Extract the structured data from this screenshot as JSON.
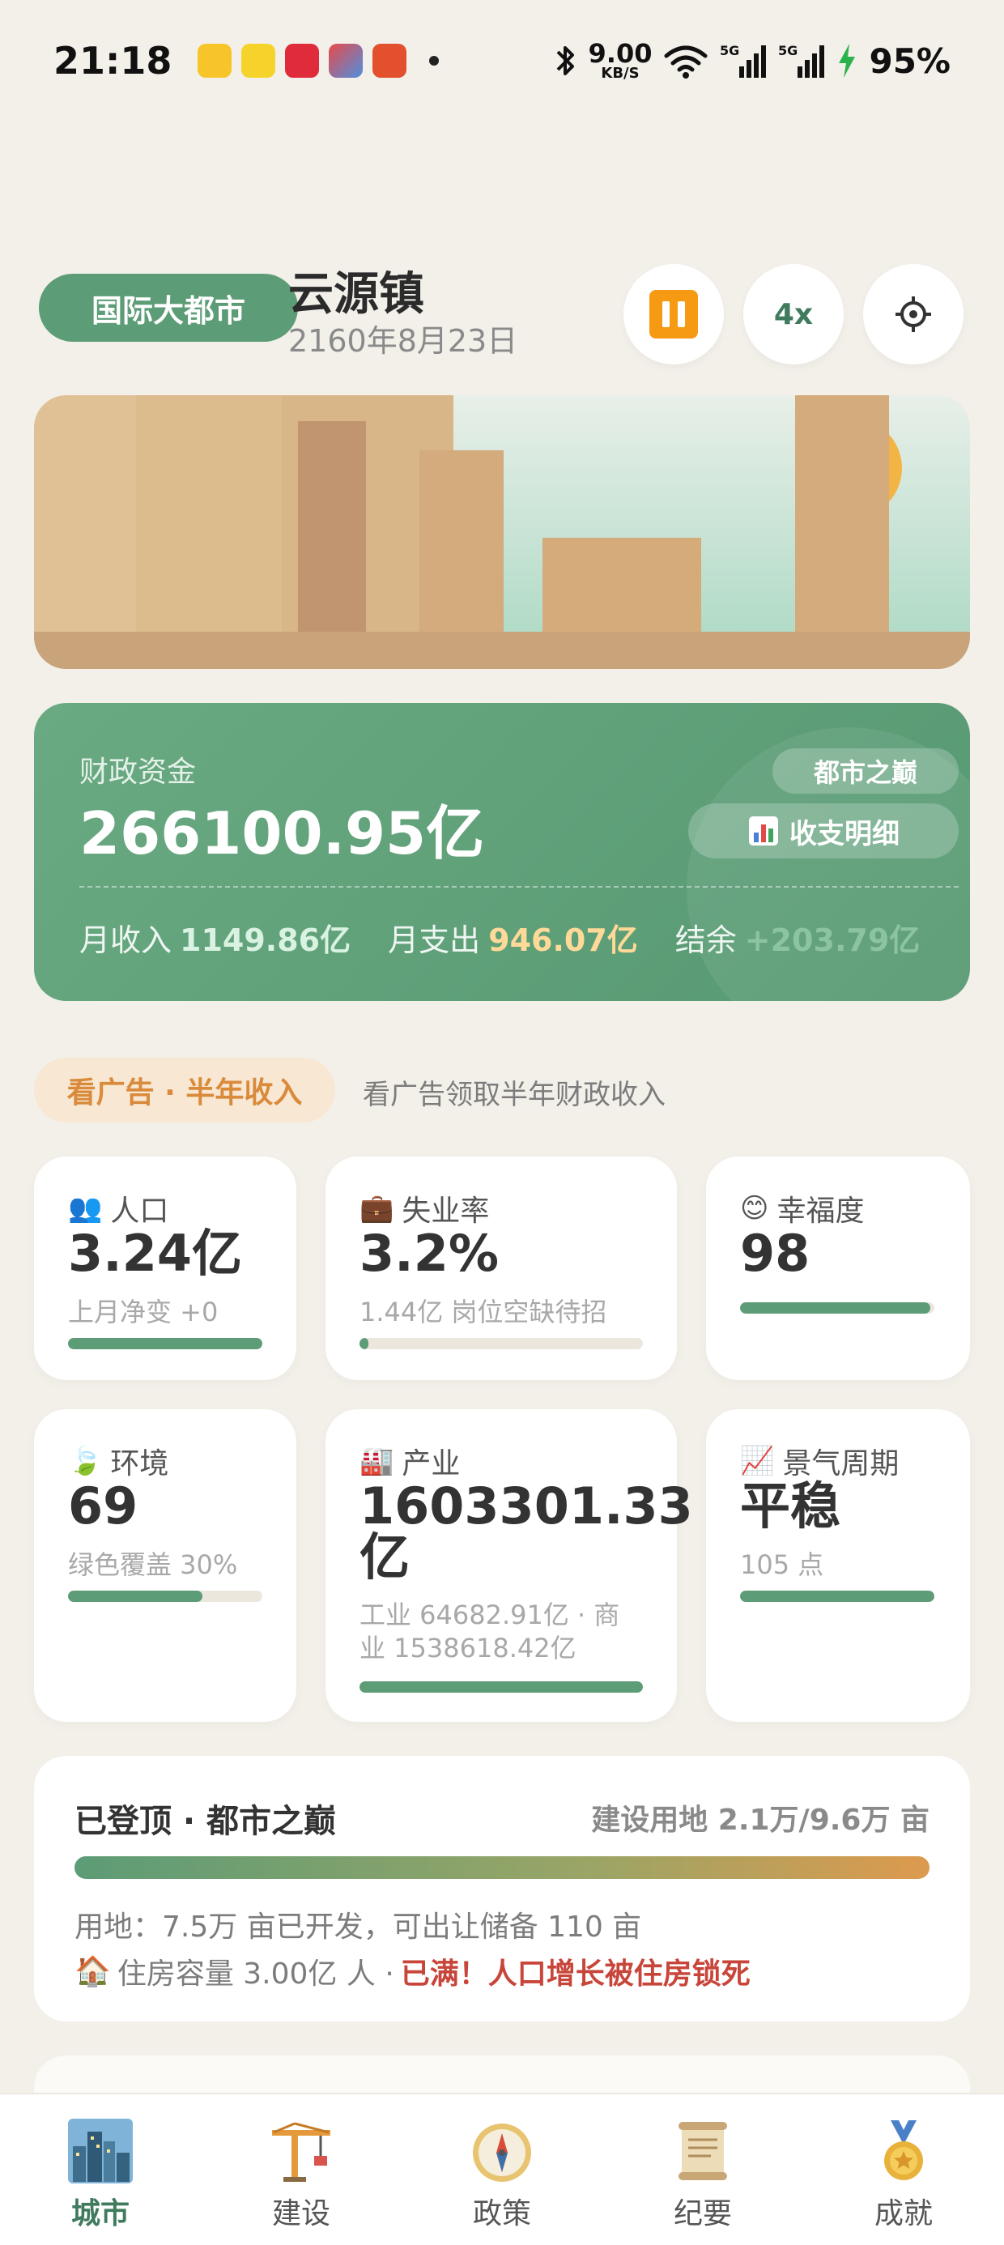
{
  "status_bar": {
    "time": "21:18",
    "net_speed": "9.00",
    "net_unit": "KB/S",
    "battery": "95%"
  },
  "header": {
    "city_level": "国际大都市",
    "city_name": "云源镇",
    "date": "2160年8月23日",
    "speed_label": "4x"
  },
  "finance": {
    "label": "财政资金",
    "amount": "266100.95亿",
    "badge": "都市之巅",
    "detail_button": "收支明细",
    "income_label": "月收入",
    "income_value": "1149.86亿",
    "expense_label": "月支出",
    "expense_value": "946.07亿",
    "balance_label": "结余",
    "balance_value": "+203.79亿"
  },
  "ad": {
    "button": "看广告 · 半年收入",
    "description": "看广告领取半年财政收入"
  },
  "stats": {
    "population": {
      "icon": "👥",
      "label": "人口",
      "value": "3.24亿",
      "sub": "上月净变 +0",
      "progress": 1.0
    },
    "unemployment": {
      "icon": "💼",
      "label": "失业率",
      "value": "3.2%",
      "sub": "1.44亿 岗位空缺待招",
      "progress": 0.032
    },
    "happiness": {
      "icon": "😊",
      "label": "幸福度",
      "value": "98",
      "progress": 0.98
    },
    "environment": {
      "icon": "🍃",
      "label": "环境",
      "value": "69",
      "sub": "绿色覆盖 30%",
      "progress": 0.69
    },
    "industry": {
      "icon": "🏭",
      "label": "产业",
      "value_line1": "1603301.33",
      "value_line2": "亿",
      "sub_line1": "工业 64682.91亿 · 商",
      "sub_line2": "业 1538618.42亿",
      "progress": 1.0
    },
    "economy": {
      "icon": "📈",
      "label": "景气周期",
      "value": "平稳",
      "sub": "105 点",
      "progress": 1.0
    }
  },
  "summit": {
    "title": "已登顶 · 都市之巅",
    "land": "建设用地 2.1万/9.6万 亩",
    "line1": "用地：7.5万 亩已开发，可出让储备 110 亩",
    "housing_icon": "🏠",
    "housing_text": "住房容量 3.00亿 人 ·",
    "housing_warning": "已满！人口增长被住房锁死"
  },
  "nav": {
    "items": [
      {
        "label": "城市",
        "icon": "city-icon",
        "active": true
      },
      {
        "label": "建设",
        "icon": "crane-icon",
        "active": false
      },
      {
        "label": "政策",
        "icon": "compass-icon",
        "active": false
      },
      {
        "label": "纪要",
        "icon": "scroll-icon",
        "active": false
      },
      {
        "label": "成就",
        "icon": "medal-icon",
        "active": false
      }
    ]
  },
  "colors": {
    "accent_green": "#5c9c76",
    "pause_orange": "#f59a12",
    "warning_red": "#c8453a",
    "background": "#f3f0ea"
  }
}
